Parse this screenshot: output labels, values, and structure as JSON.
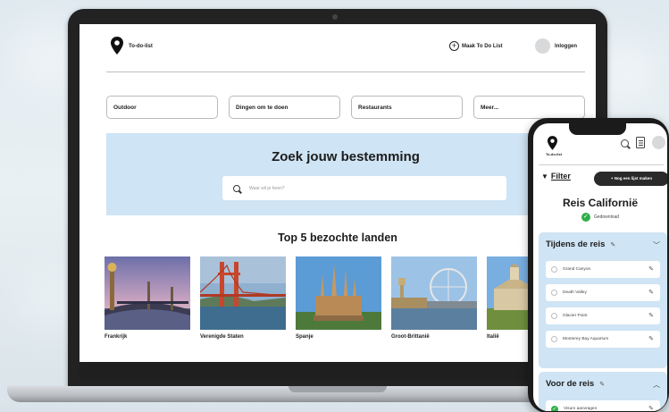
{
  "laptop": {
    "header": {
      "logo_text": "To-do-list",
      "mark_button": "Maak To Do List",
      "login": "Inloggen"
    },
    "categories": [
      "Outdoor",
      "Dingen om te doen",
      "Restaurants",
      "Meer..."
    ],
    "hero": {
      "title": "Zoek jouw bestemming",
      "search_placeholder": "Waar wil je heen?"
    },
    "top_section_title": "Top 5 bezochte landen",
    "countries": [
      "Frankrijk",
      "Verenigde Staten",
      "Spanje",
      "Groot-Brittanië",
      "Italië"
    ]
  },
  "phone": {
    "logo_text": "To-do-list",
    "filter_label": "Filter",
    "new_list_button": "+ Nog een lijst maken",
    "trip_title": "Reis Californië",
    "download_status": "Gedownload",
    "during_trip": {
      "title": "Tijdens de reis",
      "items": [
        "Grand Canyon",
        "Death Valley",
        "Glacier Point",
        "Monterey Bay Aquarium"
      ]
    },
    "before_trip": {
      "title": "Voor de reis",
      "items": [
        "Visum aanvragen"
      ]
    }
  },
  "colors": {
    "hero_bg": "#cfe4f4",
    "check_green": "#2fae4a",
    "dark_button": "#2a2a2a"
  }
}
